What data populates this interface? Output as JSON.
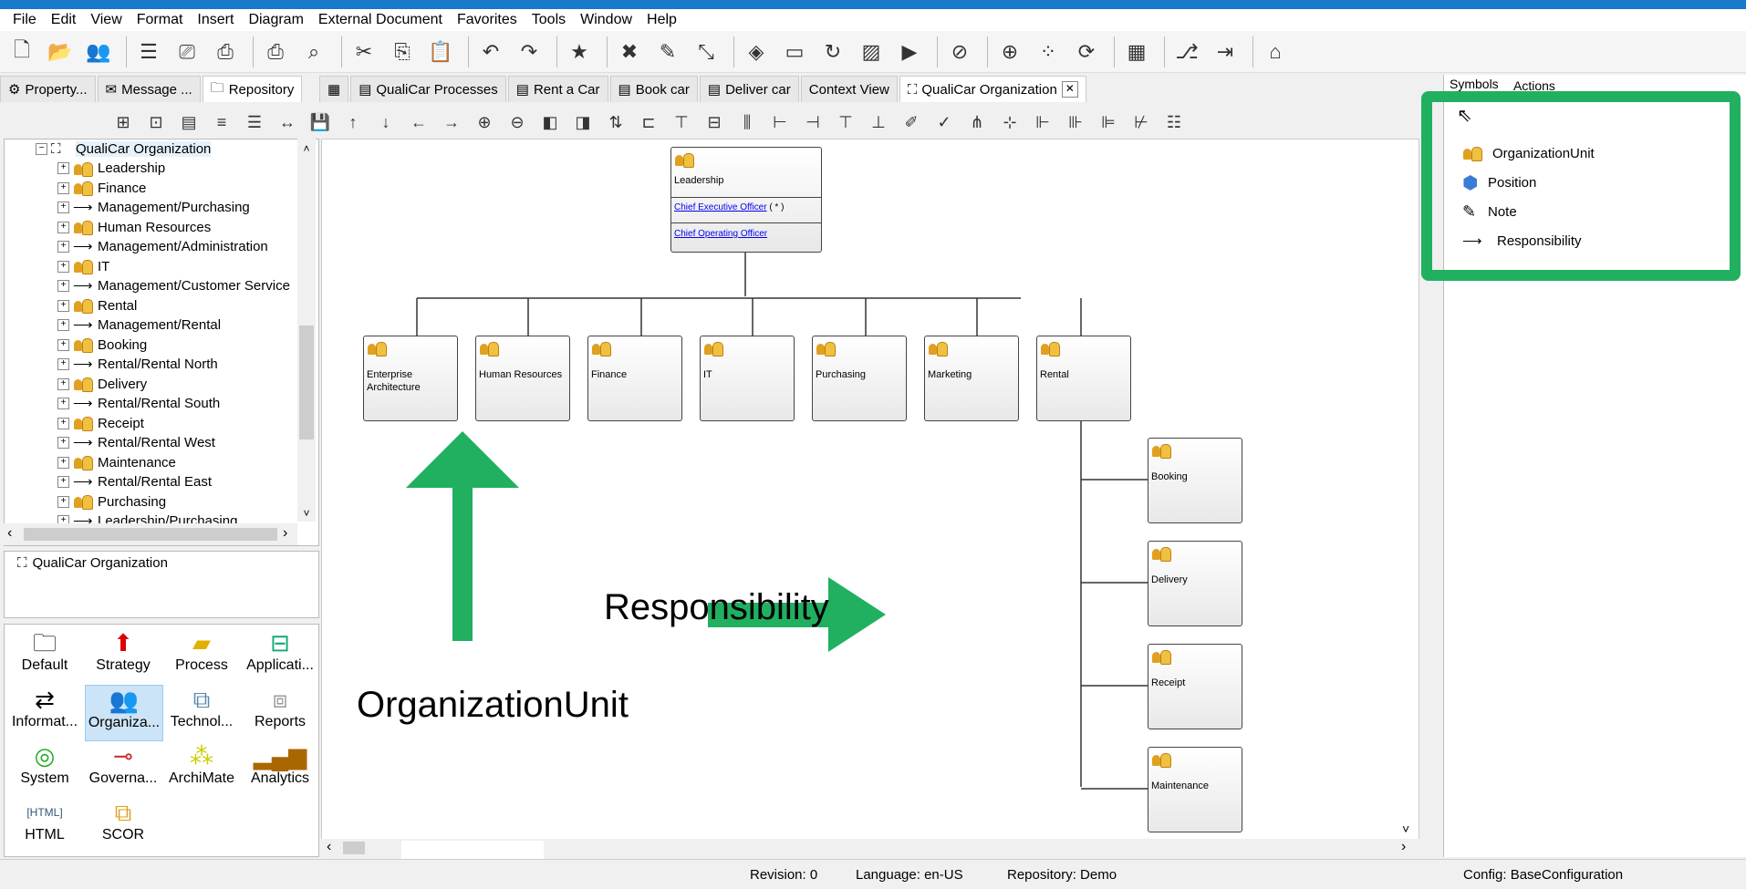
{
  "menu": [
    "File",
    "Edit",
    "View",
    "Format",
    "Insert",
    "Diagram",
    "External Document",
    "Favorites",
    "Tools",
    "Window",
    "Help"
  ],
  "left_tabs": [
    {
      "label": "Property...",
      "icon": "gear-icon"
    },
    {
      "label": "Message ...",
      "icon": "message-icon"
    },
    {
      "label": "Repository",
      "icon": "folder-icon"
    }
  ],
  "main_tabs": [
    {
      "label": "QualiCar Processes"
    },
    {
      "label": "Rent a Car"
    },
    {
      "label": "Book car"
    },
    {
      "label": "Deliver car"
    },
    {
      "label": "Context View"
    },
    {
      "label": "QualiCar Organization"
    }
  ],
  "tree": {
    "root": "QualiCar Organization",
    "items": [
      {
        "label": "Leadership",
        "type": "org"
      },
      {
        "label": "Finance",
        "type": "org"
      },
      {
        "label": "Management/Purchasing",
        "type": "resp"
      },
      {
        "label": "Human Resources",
        "type": "org"
      },
      {
        "label": "Management/Administration",
        "type": "resp"
      },
      {
        "label": "IT",
        "type": "org"
      },
      {
        "label": "Management/Customer Service",
        "type": "resp"
      },
      {
        "label": "Rental",
        "type": "org"
      },
      {
        "label": "Management/Rental",
        "type": "resp"
      },
      {
        "label": "Booking",
        "type": "org"
      },
      {
        "label": "Rental/Rental North",
        "type": "resp"
      },
      {
        "label": "Delivery",
        "type": "org"
      },
      {
        "label": "Rental/Rental South",
        "type": "resp"
      },
      {
        "label": "Receipt",
        "type": "org"
      },
      {
        "label": "Rental/Rental West",
        "type": "resp"
      },
      {
        "label": "Maintenance",
        "type": "org"
      },
      {
        "label": "Rental/Rental East",
        "type": "resp"
      },
      {
        "label": "Purchasing",
        "type": "org"
      },
      {
        "label": "Leadership/Purchasing",
        "type": "resp"
      }
    ]
  },
  "properties_item": "QualiCar Organization",
  "palette": [
    {
      "label": "Default"
    },
    {
      "label": "Strategy"
    },
    {
      "label": "Process"
    },
    {
      "label": "Applicati..."
    },
    {
      "label": "Informat..."
    },
    {
      "label": "Organiza..."
    },
    {
      "label": "Technol..."
    },
    {
      "label": "Reports"
    },
    {
      "label": "System"
    },
    {
      "label": "Governa..."
    },
    {
      "label": "ArchiMate"
    },
    {
      "label": "Analytics"
    },
    {
      "label": "HTML"
    },
    {
      "label": "SCOR"
    }
  ],
  "diagram": {
    "top": {
      "label": "Leadership",
      "pos1": "Chief Executive Officer",
      "pos1_suffix": "( * )",
      "pos2": "Chief Operating Officer"
    },
    "row": [
      "Enterprise Architecture",
      "Human Resources",
      "Finance",
      "IT",
      "Purchasing",
      "Marketing",
      "Rental"
    ],
    "sub": [
      "Booking",
      "Delivery",
      "Receipt",
      "Maintenance"
    ]
  },
  "annotations": {
    "responsibility": "Responsibility",
    "org_unit": "OrganizationUnit"
  },
  "symbols": {
    "tabs": [
      "Symbols",
      "Actions"
    ],
    "items": [
      "OrganizationUnit",
      "Position",
      "Note",
      "Responsibility"
    ]
  },
  "status": {
    "revision": "Revision: 0",
    "language": "Language: en-US",
    "repository": "Repository: Demo",
    "config": "Config: BaseConfiguration"
  },
  "colors": {
    "accent": "#1979ca",
    "highlight": "#20b060"
  }
}
